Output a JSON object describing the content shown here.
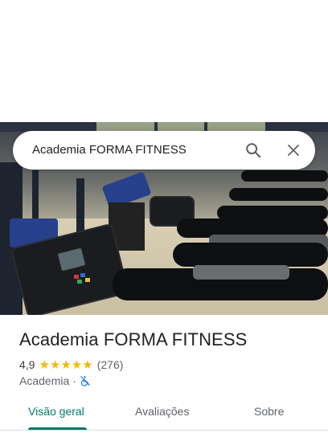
{
  "search": {
    "query": "Academia FORMA FITNESS",
    "search_icon": "search-icon",
    "close_icon": "close-icon"
  },
  "place": {
    "name": "Academia FORMA FITNESS",
    "rating": "4,9",
    "stars_display": "★★★★★",
    "stars_value": 4.9,
    "review_count": "(276)",
    "category": "Academia",
    "separator": "·",
    "accessibility_icon": "no-wheelchair-access-icon"
  },
  "tabs": [
    {
      "label": "Visão geral",
      "active": true
    },
    {
      "label": "Avaliações",
      "active": false
    },
    {
      "label": "Sobre",
      "active": false
    }
  ],
  "colors": {
    "accent": "#00796b",
    "star": "#f5b70a",
    "accessibility_icon": "#1a73e8"
  }
}
